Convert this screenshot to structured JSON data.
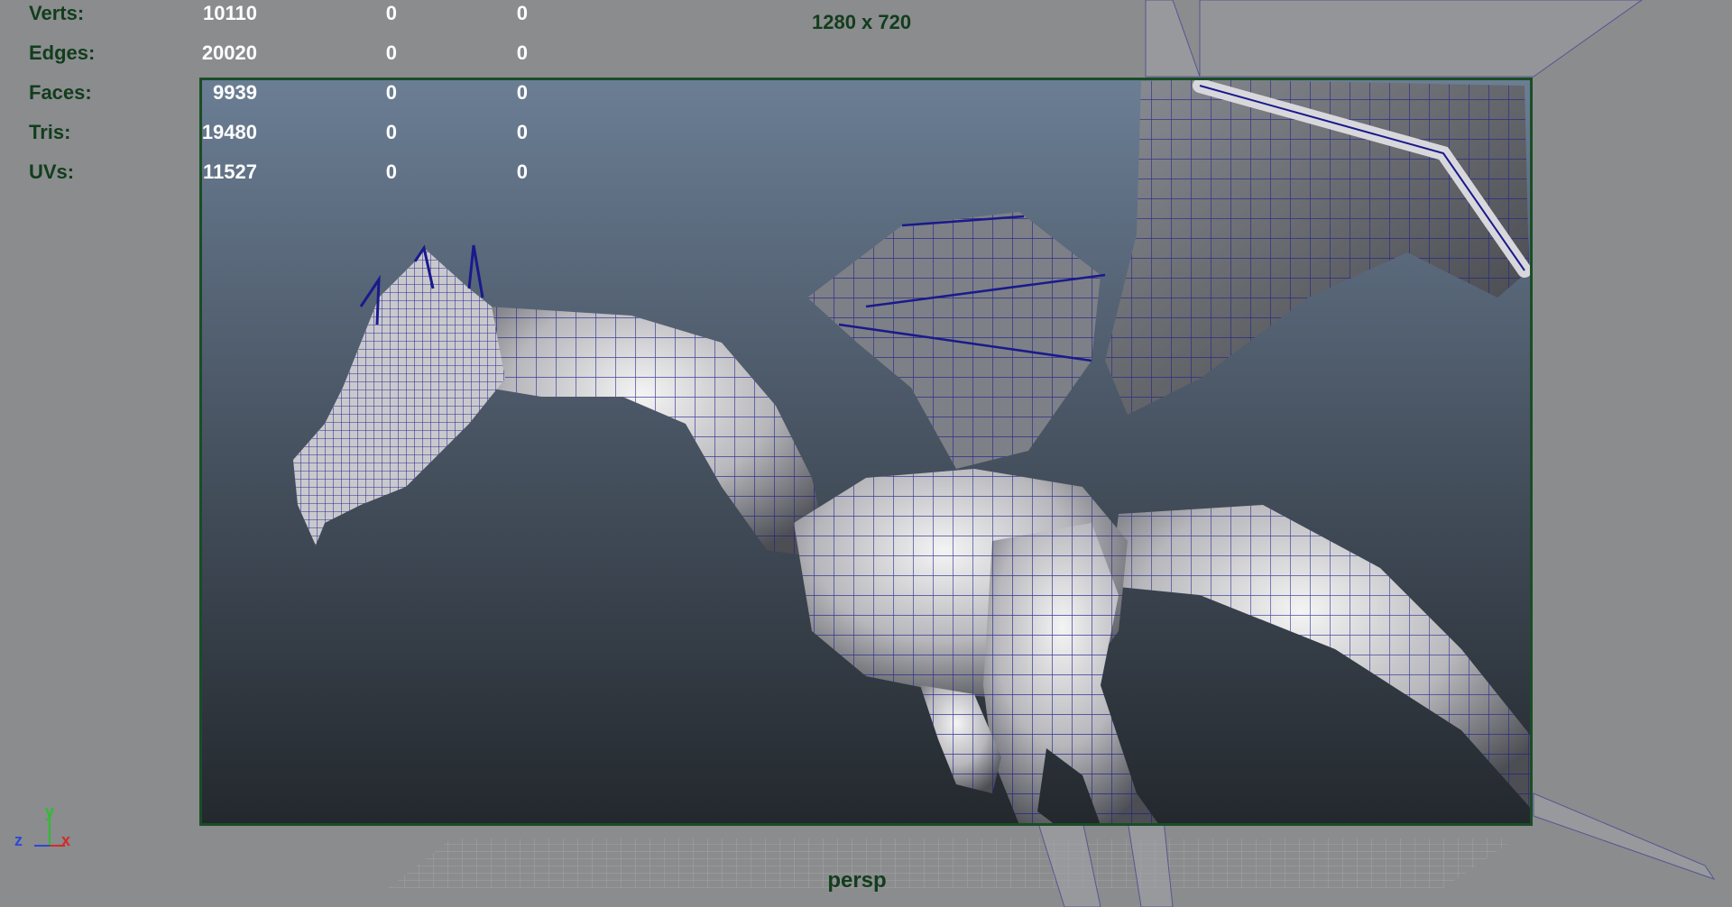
{
  "viewport": {
    "camera_name": "persp",
    "resolution_label": "1280 x 720"
  },
  "hud": {
    "rows": [
      {
        "label": "Verts:",
        "values": [
          "10110",
          "0",
          "0"
        ]
      },
      {
        "label": "Edges:",
        "values": [
          "20020",
          "0",
          "0"
        ]
      },
      {
        "label": "Faces:",
        "values": [
          "9939",
          "0",
          "0"
        ]
      },
      {
        "label": "Tris:",
        "values": [
          "19480",
          "0",
          "0"
        ]
      },
      {
        "label": "UVs:",
        "values": [
          "11527",
          "0",
          "0"
        ]
      }
    ]
  },
  "axis": {
    "x": "x",
    "y": "y",
    "z": "z"
  },
  "colors": {
    "background": "#8a8c8e",
    "hud_label": "#123d1c",
    "hud_value": "#ffffff",
    "wireframe": "#1a1a8c",
    "gate": "#1a4d26"
  },
  "icons": [
    "axis-gizmo-icon"
  ]
}
